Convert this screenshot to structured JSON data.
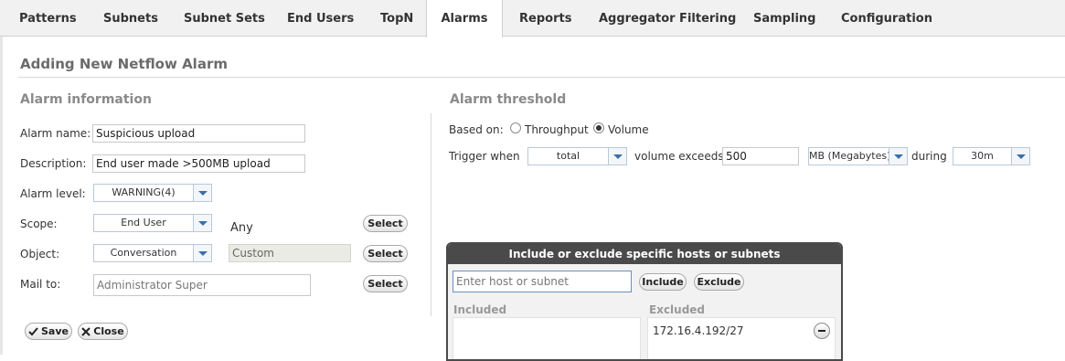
{
  "tabs": [
    {
      "label": "Patterns",
      "active": false
    },
    {
      "label": "Subnets",
      "active": false
    },
    {
      "label": "Subnet Sets",
      "active": false
    },
    {
      "label": "End Users",
      "active": false
    },
    {
      "label": "TopN",
      "active": false
    },
    {
      "label": "Alarms",
      "active": true
    },
    {
      "label": "Reports",
      "active": false
    },
    {
      "label": "Aggregator Filtering",
      "active": false
    },
    {
      "label": "Sampling",
      "active": false
    },
    {
      "label": "Configuration",
      "active": false
    }
  ],
  "page_title": "Adding New Netflow Alarm",
  "alarm_info": {
    "heading": "Alarm information",
    "name_label": "Alarm name:",
    "name_value": "Suspicious upload",
    "description_label": "Description:",
    "description_value": "End user made >500MB upload",
    "level_label": "Alarm level:",
    "level_value": "WARNING(4)",
    "scope_label": "Scope:",
    "scope_value": "End User",
    "scope_text": "Any",
    "object_label": "Object:",
    "object_value": "Conversation",
    "object_text": "Custom",
    "mail_label": "Mail to:",
    "mail_placeholder": "Administrator Super",
    "select_label": "Select"
  },
  "actions": {
    "save_label": "Save",
    "close_label": "Close"
  },
  "threshold": {
    "heading": "Alarm threshold",
    "based_on_label": "Based on:",
    "throughput_label": "Throughput",
    "volume_label": "Volume",
    "selected": "Volume",
    "trigger_label": "Trigger when",
    "trigger_value": "total",
    "exceeds_label": "volume exceeds",
    "exceeds_value": "500",
    "unit_value": "MB (Megabytes)",
    "during_label": "during",
    "during_value": "30m"
  },
  "hosts_panel": {
    "title": "Include or exclude specific hosts or subnets",
    "input_placeholder": "Enter host or subnet",
    "include_label": "Include",
    "exclude_label": "Exclude",
    "included_header": "Included",
    "excluded_header": "Excluded",
    "included_items": [],
    "excluded_items": [
      "172.16.4.192/27"
    ]
  },
  "colors": {
    "tab_bg": "#f1f1f1",
    "panel_header": "#4a4a4a",
    "select_arrow": "#3b6fa8"
  }
}
